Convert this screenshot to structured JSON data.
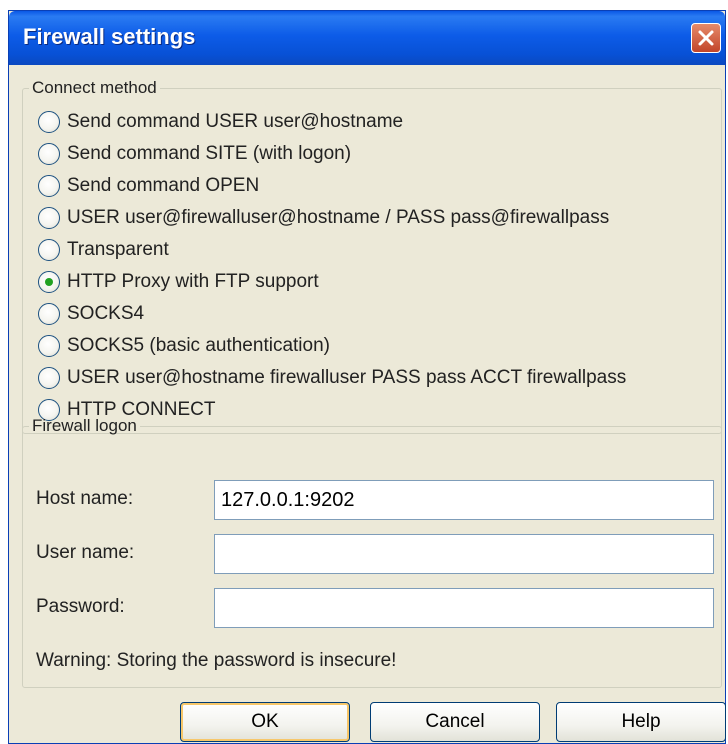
{
  "window": {
    "title": "Firewall settings"
  },
  "connect_method": {
    "legend": "Connect method",
    "options": [
      {
        "label": "Send command USER user@hostname",
        "checked": false
      },
      {
        "label": "Send command SITE (with logon)",
        "checked": false
      },
      {
        "label": "Send command OPEN",
        "checked": false
      },
      {
        "label": "USER user@firewalluser@hostname / PASS pass@firewallpass",
        "checked": false
      },
      {
        "label": "Transparent",
        "checked": false
      },
      {
        "label": "HTTP Proxy with FTP support",
        "checked": true
      },
      {
        "label": "SOCKS4",
        "checked": false
      },
      {
        "label": "SOCKS5 (basic authentication)",
        "checked": false
      },
      {
        "label": "USER user@hostname firewalluser PASS pass ACCT firewallpass",
        "checked": false
      },
      {
        "label": "HTTP CONNECT",
        "checked": false
      }
    ]
  },
  "firewall_logon": {
    "legend": "Firewall logon",
    "host_label": "Host name:",
    "host_value": "127.0.0.1:9202",
    "user_label": "User name:",
    "user_value": "",
    "password_label": "Password:",
    "password_value": "",
    "warning": "Warning: Storing the password is insecure!"
  },
  "buttons": {
    "ok": "OK",
    "cancel": "Cancel",
    "help": "Help"
  }
}
